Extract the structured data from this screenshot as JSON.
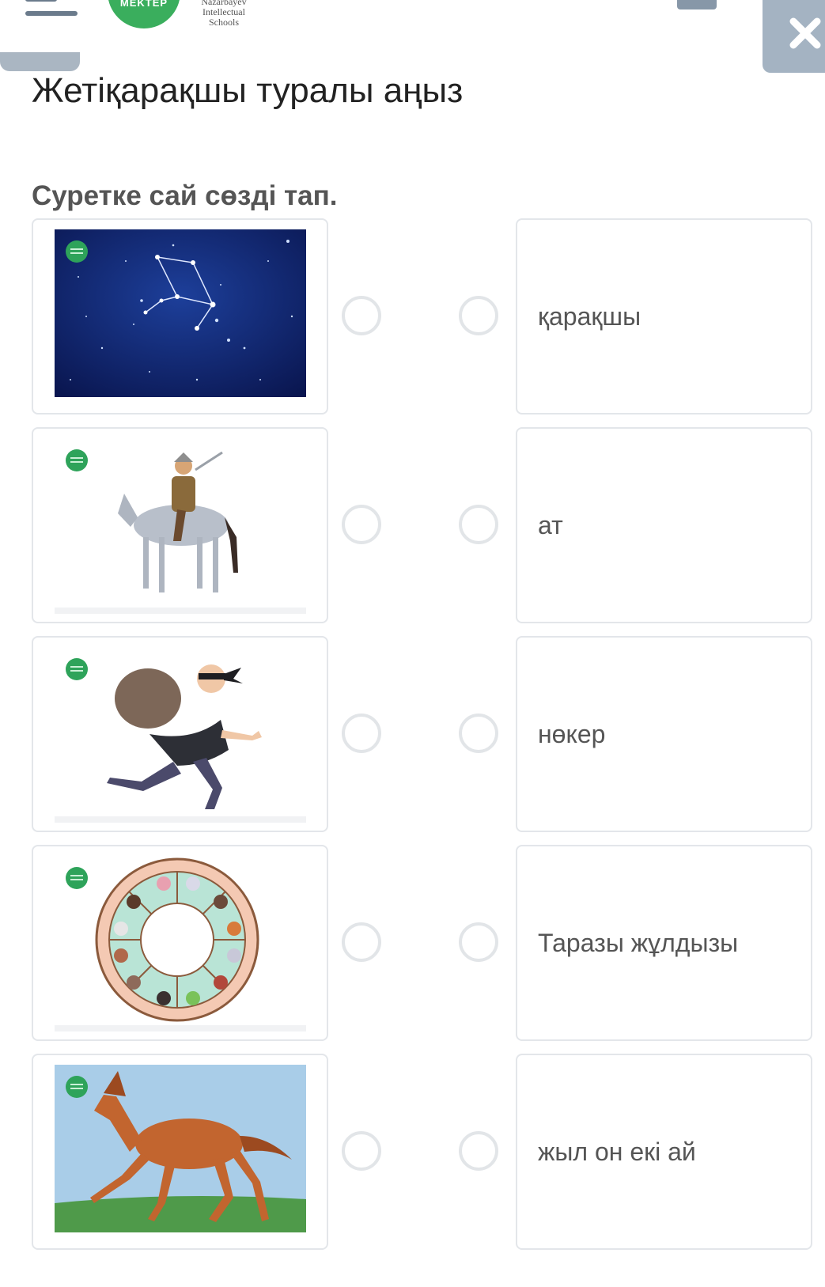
{
  "header": {
    "logo_text": "MEKTEP",
    "school_name": [
      "Nazarbayev",
      "Intellectual",
      "Schools"
    ]
  },
  "page_title": "Жетіқарақшы туралы аңыз",
  "question": "Суретке сай сөзді тап.",
  "images": [
    {
      "icon": "constellation-image"
    },
    {
      "icon": "warrior-on-horse-image"
    },
    {
      "icon": "thief-image"
    },
    {
      "icon": "zodiac-wheel-image"
    },
    {
      "icon": "horse-image"
    }
  ],
  "words": [
    {
      "label": "қарақшы"
    },
    {
      "label": "ат"
    },
    {
      "label": "нөкер"
    },
    {
      "label": "Таразы жұлдызы"
    },
    {
      "label": "жыл он екі ай"
    }
  ]
}
